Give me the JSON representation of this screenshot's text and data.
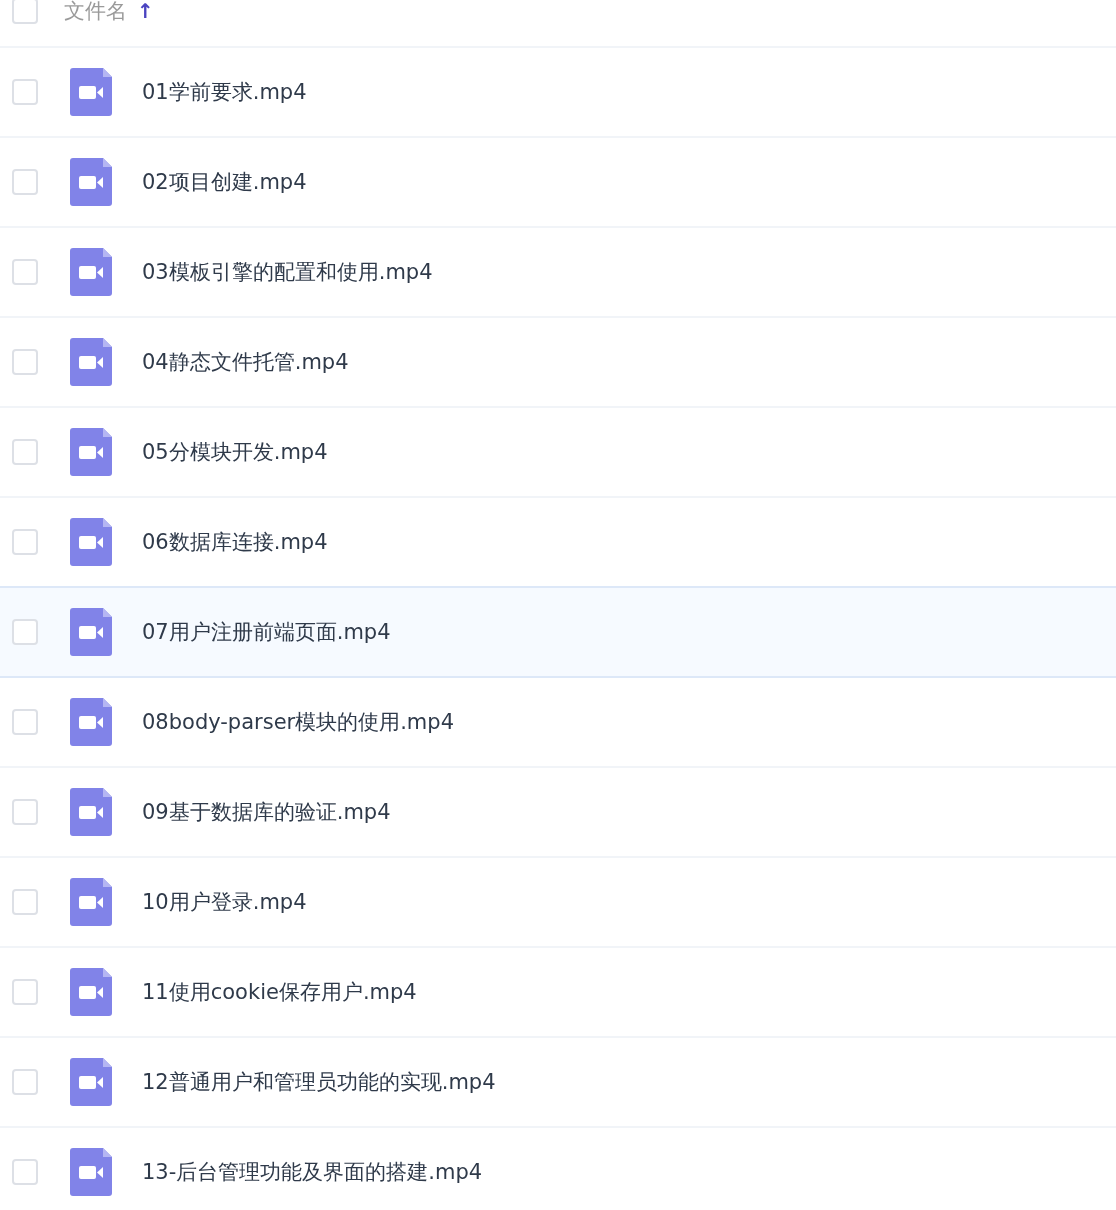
{
  "header": {
    "checked": false,
    "column_label": "文件名",
    "sort_arrow": "↑"
  },
  "files": [
    {
      "name": "01学前要求.mp4",
      "checked": false,
      "highlighted": false
    },
    {
      "name": "02项目创建.mp4",
      "checked": false,
      "highlighted": false
    },
    {
      "name": "03模板引擎的配置和使用.mp4",
      "checked": false,
      "highlighted": false
    },
    {
      "name": "04静态文件托管.mp4",
      "checked": false,
      "highlighted": false
    },
    {
      "name": "05分模块开发.mp4",
      "checked": false,
      "highlighted": false
    },
    {
      "name": "06数据库连接.mp4",
      "checked": false,
      "highlighted": false
    },
    {
      "name": "07用户注册前端页面.mp4",
      "checked": false,
      "highlighted": true
    },
    {
      "name": "08body-parser模块的使用.mp4",
      "checked": false,
      "highlighted": false
    },
    {
      "name": "09基于数据库的验证.mp4",
      "checked": false,
      "highlighted": false
    },
    {
      "name": "10用户登录.mp4",
      "checked": false,
      "highlighted": false
    },
    {
      "name": "11使用cookie保存用户.mp4",
      "checked": false,
      "highlighted": false
    },
    {
      "name": "12普通用户和管理员功能的实现.mp4",
      "checked": false,
      "highlighted": false
    },
    {
      "name": "13-后台管理功能及界面的搭建.mp4",
      "checked": false,
      "highlighted": false
    }
  ]
}
